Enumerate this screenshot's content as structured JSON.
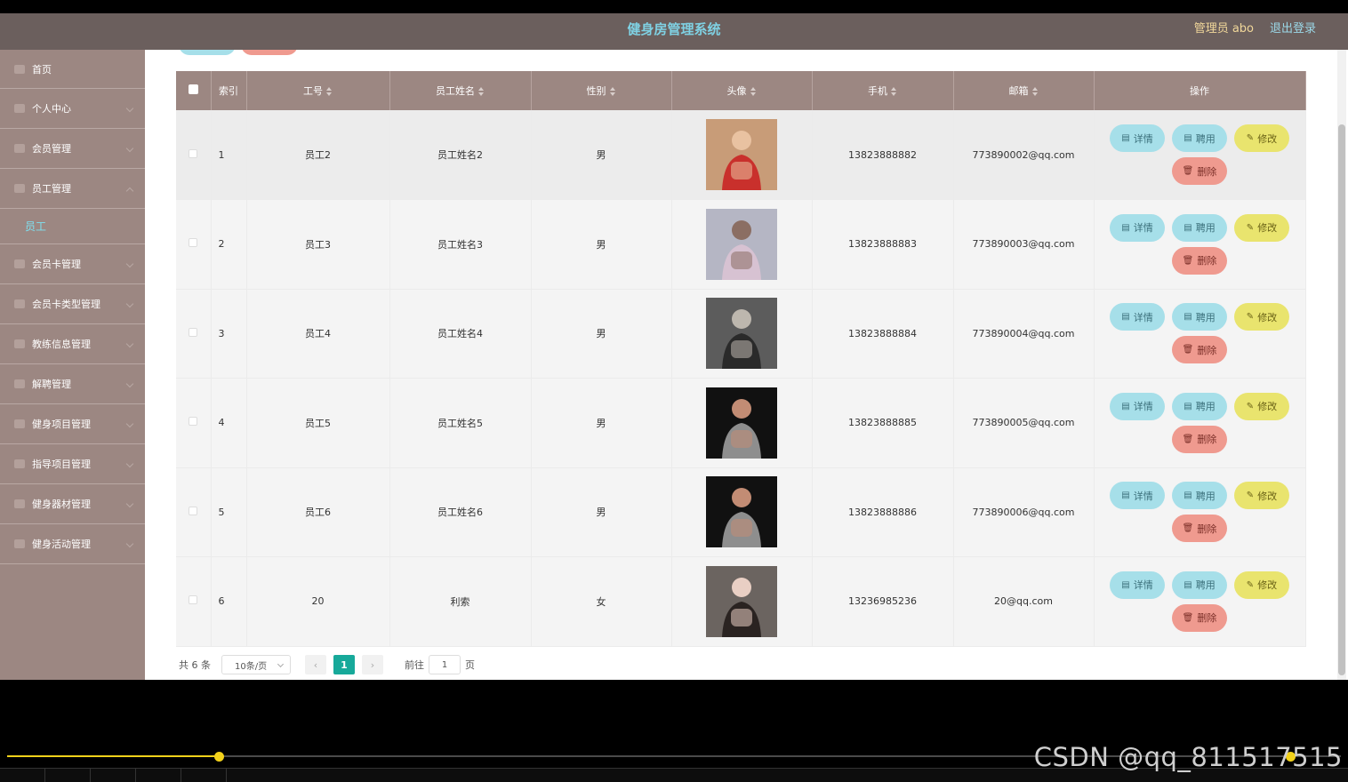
{
  "header": {
    "title": "健身房管理系统",
    "admin": "管理员 abo",
    "logout": "退出登录"
  },
  "sidebar": {
    "items": [
      {
        "label": "首页",
        "icon": "home-icon"
      },
      {
        "label": "个人中心",
        "icon": "user-icon"
      },
      {
        "label": "会员管理",
        "icon": "bookmark-icon"
      },
      {
        "label": "员工管理",
        "icon": "folder-icon"
      },
      {
        "label": "会员卡管理",
        "icon": "card-icon"
      },
      {
        "label": "会员卡类型管理",
        "icon": "list-icon"
      },
      {
        "label": "教练信息管理",
        "icon": "chat-icon"
      },
      {
        "label": "解聘管理",
        "icon": "folder-icon"
      },
      {
        "label": "健身项目管理",
        "icon": "grid-icon"
      },
      {
        "label": "指导项目管理",
        "icon": "grid-icon"
      },
      {
        "label": "健身器材管理",
        "icon": "user-icon"
      },
      {
        "label": "健身活动管理",
        "icon": "grid-icon"
      }
    ],
    "submenu": {
      "label": "员工"
    }
  },
  "table": {
    "headers": {
      "index": "索引",
      "emp_no": "工号",
      "name": "员工姓名",
      "gender": "性别",
      "avatar": "头像",
      "phone": "手机",
      "email": "邮箱",
      "ops": "操作"
    },
    "rows": [
      {
        "index": "1",
        "emp_no": "员工2",
        "name": "员工姓名2",
        "gender": "男",
        "phone": "13823888882",
        "email": "773890002@qq.com",
        "avatar": {
          "bg": "#c89c78",
          "fg": "#e9c2a1",
          "accent": "#c9302c"
        }
      },
      {
        "index": "2",
        "emp_no": "员工3",
        "name": "员工姓名3",
        "gender": "男",
        "phone": "13823888883",
        "email": "773890003@qq.com",
        "avatar": {
          "bg": "#b5b6c4",
          "fg": "#8b6e63",
          "accent": "#d7c2d2"
        }
      },
      {
        "index": "3",
        "emp_no": "员工4",
        "name": "员工姓名4",
        "gender": "男",
        "phone": "13823888884",
        "email": "773890004@qq.com",
        "avatar": {
          "bg": "#5c5c5c",
          "fg": "#bdb7ae",
          "accent": "#2a2a2a"
        }
      },
      {
        "index": "4",
        "emp_no": "员工5",
        "name": "员工姓名5",
        "gender": "男",
        "phone": "13823888885",
        "email": "773890005@qq.com",
        "avatar": {
          "bg": "#111111",
          "fg": "#c28c74",
          "accent": "#8e8e8e"
        }
      },
      {
        "index": "5",
        "emp_no": "员工6",
        "name": "员工姓名6",
        "gender": "男",
        "phone": "13823888886",
        "email": "773890006@qq.com",
        "avatar": {
          "bg": "#111111",
          "fg": "#c28c74",
          "accent": "#8e8e8e"
        }
      },
      {
        "index": "6",
        "emp_no": "20",
        "name": "利索",
        "gender": "女",
        "phone": "13236985236",
        "email": "20@qq.com",
        "avatar": {
          "bg": "#6b6460",
          "fg": "#e9cfc4",
          "accent": "#2a2321"
        }
      }
    ],
    "actions": {
      "detail": "详情",
      "hire": "聘用",
      "edit": "修改",
      "delete": "删除"
    }
  },
  "pager": {
    "total": "共 6 条",
    "page_size": "10条/页",
    "current_page": "1",
    "goto_label": "前往",
    "goto_value": "1",
    "page_suffix": "页"
  },
  "player": {
    "progress": 0.155
  },
  "watermark": "CSDN @qq_811517515",
  "colors": {
    "header": "#6b5f5d",
    "sidebar": "#9c8782",
    "accent": "#17a99a"
  }
}
